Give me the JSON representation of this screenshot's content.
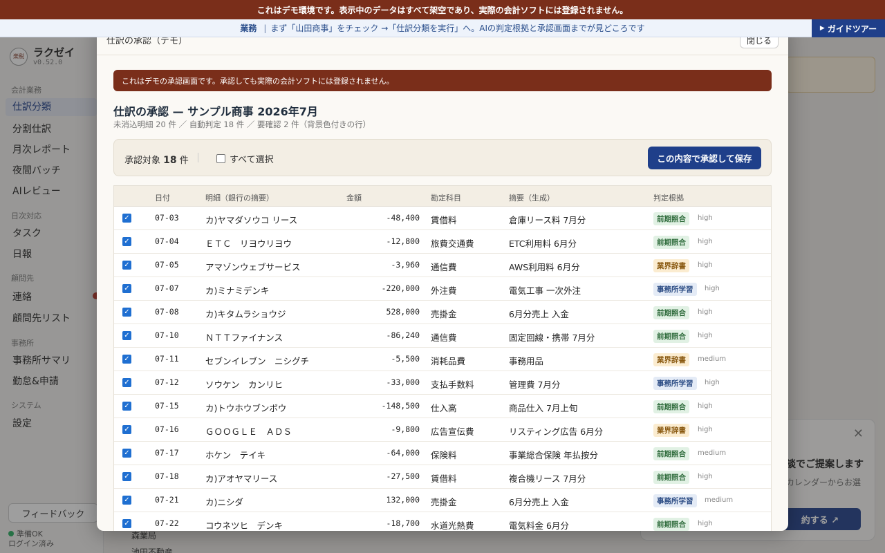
{
  "top_banner": "これはデモ環境です。表示中のデータはすべて架空であり、実際の会計ソフトには登録されません。",
  "guide": {
    "tag": "業務",
    "sep": "|",
    "text": "まず「山田商事」をチェック →「仕訳分類を実行」へ。AIの判定根拠と承認画面までが見どころです",
    "button": "ガイドツアー"
  },
  "sidebar": {
    "logo_mark": "楽税",
    "app_name": "ラクゼイ",
    "version": "v0.52.0",
    "groups": [
      {
        "label": "会計業務",
        "items": [
          "仕訳分類",
          "分割仕訳",
          "月次レポート",
          "夜間バッチ",
          "AIレビュー"
        ]
      },
      {
        "label": "日次対応",
        "items": [
          "タスク",
          "日報"
        ]
      },
      {
        "label": "顧問先",
        "items": [
          "連絡",
          "顧問先リスト"
        ]
      },
      {
        "label": "事務所",
        "items": [
          "事務所サマリ",
          "勤怠&申請"
        ]
      },
      {
        "label": "システム",
        "items": [
          "設定"
        ]
      }
    ],
    "feedback": "フィードバック",
    "status1": "準備OK",
    "status2": "ログイン済み"
  },
  "background": {
    "popup_title": "談でご提案します",
    "popup_text": "カレンダーからお選",
    "popup_button": "約する ↗",
    "peek1": "森業局",
    "peek2": "池田不動産"
  },
  "modal": {
    "title": "仕訳の承認（デモ）",
    "close": "閉じる",
    "notice": "これはデモの承認画面です。承認しても実際の会計ソフトには登録されません。",
    "heading": "仕訳の承認 — サンプル商事 2026年7月",
    "subheading": "未消込明細 20 件 ／ 自動判定 18 件 ／ 要確認 2 件（背景色付きの行）",
    "approve_label": "承認対象",
    "approve_count": "18",
    "approve_unit": "件",
    "select_all": "すべて選択",
    "save_button": "この内容で承認して保存",
    "columns": [
      "日付",
      "明細（銀行の摘要）",
      "金額",
      "勘定科目",
      "摘要（生成）",
      "判定根拠"
    ],
    "rows": [
      {
        "date": "07-03",
        "desc": "カ)ヤマダソウコ リース",
        "amount": "-48,400",
        "account": "賃借料",
        "memo": "倉庫リース料 7月分",
        "basis": "前期照合",
        "conf": "high"
      },
      {
        "date": "07-04",
        "desc": "ＥＴＣ　リヨウリヨウ",
        "amount": "-12,800",
        "account": "旅費交通費",
        "memo": "ETC利用料 6月分",
        "basis": "前期照合",
        "conf": "high"
      },
      {
        "date": "07-05",
        "desc": "アマゾンウェブサービス",
        "amount": "-3,960",
        "account": "通信費",
        "memo": "AWS利用料 6月分",
        "basis": "業界辞書",
        "conf": "high"
      },
      {
        "date": "07-07",
        "desc": "カ)ミナミデンキ",
        "amount": "-220,000",
        "account": "外注費",
        "memo": "電気工事 一次外注",
        "basis": "事務所学習",
        "conf": "high"
      },
      {
        "date": "07-08",
        "desc": "カ)キタムラショウジ",
        "amount": "528,000",
        "account": "売掛金",
        "memo": "6月分売上 入金",
        "basis": "前期照合",
        "conf": "high"
      },
      {
        "date": "07-10",
        "desc": "ＮＴＴファイナンス",
        "amount": "-86,240",
        "account": "通信費",
        "memo": "固定回線・携帯 7月分",
        "basis": "前期照合",
        "conf": "high"
      },
      {
        "date": "07-11",
        "desc": "セブンイレブン　ニシグチ",
        "amount": "-5,500",
        "account": "消耗品費",
        "memo": "事務用品",
        "basis": "業界辞書",
        "conf": "medium"
      },
      {
        "date": "07-12",
        "desc": "ソウケン　カンリヒ",
        "amount": "-33,000",
        "account": "支払手数料",
        "memo": "管理費 7月分",
        "basis": "事務所学習",
        "conf": "high"
      },
      {
        "date": "07-15",
        "desc": "カ)トウホウブンボウ",
        "amount": "-148,500",
        "account": "仕入高",
        "memo": "商品仕入 7月上旬",
        "basis": "前期照合",
        "conf": "high"
      },
      {
        "date": "07-16",
        "desc": "ＧＯＯＧＬＥ　ＡＤＳ",
        "amount": "-9,800",
        "account": "広告宣伝費",
        "memo": "リスティング広告 6月分",
        "basis": "業界辞書",
        "conf": "high"
      },
      {
        "date": "07-17",
        "desc": "ホケン　テイキ",
        "amount": "-64,000",
        "account": "保険料",
        "memo": "事業総合保険 年払按分",
        "basis": "前期照合",
        "conf": "medium"
      },
      {
        "date": "07-18",
        "desc": "カ)アオヤマリース",
        "amount": "-27,500",
        "account": "賃借料",
        "memo": "複合機リース 7月分",
        "basis": "前期照合",
        "conf": "high"
      },
      {
        "date": "07-21",
        "desc": "カ)ニシダ",
        "amount": "132,000",
        "account": "売掛金",
        "memo": "6月分売上 入金",
        "basis": "事務所学習",
        "conf": "medium"
      },
      {
        "date": "07-22",
        "desc": "コウネツヒ　デンキ",
        "amount": "-18,700",
        "account": "水道光熱費",
        "memo": "電気料金 6月分",
        "basis": "前期照合",
        "conf": "high"
      }
    ]
  }
}
